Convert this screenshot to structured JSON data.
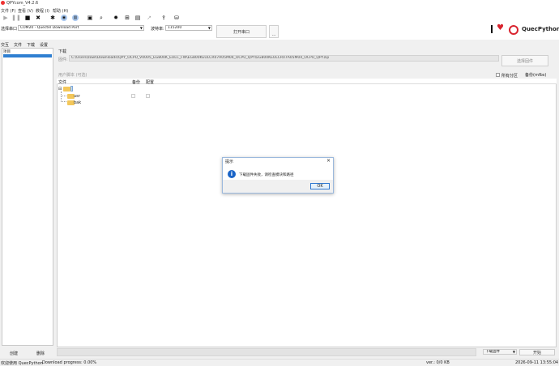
{
  "window": {
    "title": "QPYcom_V4.2.6"
  },
  "menu": [
    "文件 (F)",
    "查看 (V)",
    "教程 (I)",
    "帮助 (H)"
  ],
  "toolbar_icons": [
    "play-icon",
    "pause-icon",
    "stop-icon",
    "close-icon",
    "bug-icon",
    "circle-tool-icon",
    "chart-tool-icon",
    "save-icon",
    "search-icon",
    "gear-icon",
    "plus-box-icon",
    "edit-box-icon",
    "external-link-icon",
    "upload-icon",
    "download-icon",
    "package-icon"
  ],
  "port": {
    "label": "选择串口",
    "value": "COM20 - Quectel Download Port",
    "baud_label": "波特率:",
    "baud_value": "115200",
    "open_button": "打开串口",
    "more_button": "..."
  },
  "brand": {
    "name": "QuecPython",
    "accent": "#d9232e"
  },
  "tabs": [
    "交互",
    "文件",
    "下载",
    "设置"
  ],
  "left_panel": {
    "header": "项目"
  },
  "download": {
    "section_title": "下载",
    "path_label": "固件:",
    "path_value": "C:\\Users\\zowl\\Downloads\\QPY_OCPU_V0005_EG800K_EULC_FW\\EG800KEULCR07A05M04_OCPU_QPY\\EG800KEULCR07A05M04_OCPU_QPY.zip",
    "select_firmware_button": "选择固件",
    "user_script_label": "用户脚本 (可选)",
    "merge_label": "所有分区",
    "backup_button": "备份(mfbs)",
    "columns": {
      "file": "文件",
      "backup": "备份",
      "config": "配置"
    },
    "tree": {
      "usr": "usr",
      "bak": "bak"
    }
  },
  "bottom": {
    "create_button": "创建",
    "delete_button": "删除",
    "download_firmware_select": "下载固件",
    "start_button": "开始"
  },
  "status": {
    "left": "欢迎使用 QuecPython",
    "progress": "Download progress: 0.00%",
    "version": "ver.: 0/0 KB",
    "datetime": "2026-09-11 13:55:04"
  },
  "dialog": {
    "title": "提示",
    "message": "下载固件失败，请检查模块和路径",
    "ok": "OK"
  }
}
